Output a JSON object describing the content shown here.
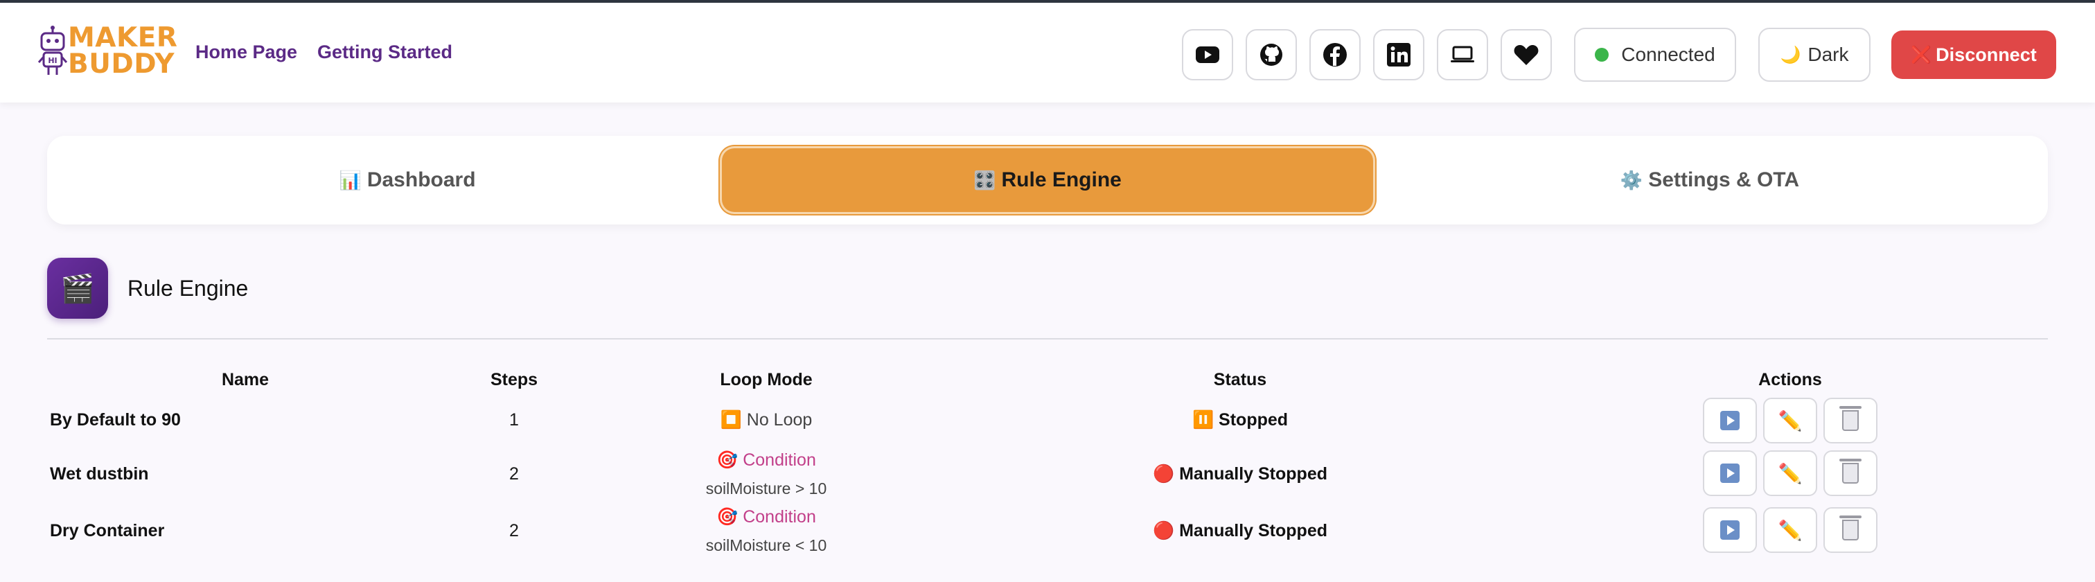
{
  "app": {
    "logo_line1": "MAKER",
    "logo_line2": "BUDDY",
    "brand_color": "#ee9a30"
  },
  "nav": {
    "home": "Home Page",
    "getting_started": "Getting Started"
  },
  "social_icons": [
    "youtube-icon",
    "github-icon",
    "facebook-icon",
    "linkedin-icon",
    "laptop-icon",
    "heart-icon"
  ],
  "connection": {
    "status_label": "Connected",
    "status_color": "#3bb54a"
  },
  "theme_toggle": {
    "emoji": "🌙",
    "label": "Dark"
  },
  "disconnect": {
    "emoji": "❌",
    "label": "Disconnect",
    "color": "#e04747"
  },
  "tabs": [
    {
      "emoji": "📊",
      "label": "Dashboard"
    },
    {
      "emoji": "🎛️",
      "label": "Rule Engine",
      "active": true
    },
    {
      "emoji": "⚙️",
      "label": "Settings & OTA"
    }
  ],
  "section": {
    "icon": "🎬",
    "title": "Rule Engine"
  },
  "table": {
    "headers": {
      "name": "Name",
      "steps": "Steps",
      "loop_mode": "Loop Mode",
      "status": "Status",
      "actions": "Actions"
    },
    "rows": [
      {
        "name": "By Default to 90",
        "steps": "1",
        "loop_emoji": "⏹️",
        "loop_mode": "No Loop",
        "loop_detail": "",
        "status_emoji": "⏸️",
        "status": "Stopped"
      },
      {
        "name": "Wet dustbin",
        "steps": "2",
        "loop_emoji": "🎯",
        "loop_mode": "Condition",
        "loop_detail": "soilMoisture > 10",
        "status_emoji": "🔴",
        "status": "Manually Stopped"
      },
      {
        "name": "Dry Container",
        "steps": "2",
        "loop_emoji": "🎯",
        "loop_mode": "Condition",
        "loop_detail": "soilMoisture < 10",
        "status_emoji": "🔴",
        "status": "Manually Stopped"
      }
    ],
    "action_icons": [
      "play-icon",
      "pencil-icon",
      "trash-icon"
    ]
  }
}
